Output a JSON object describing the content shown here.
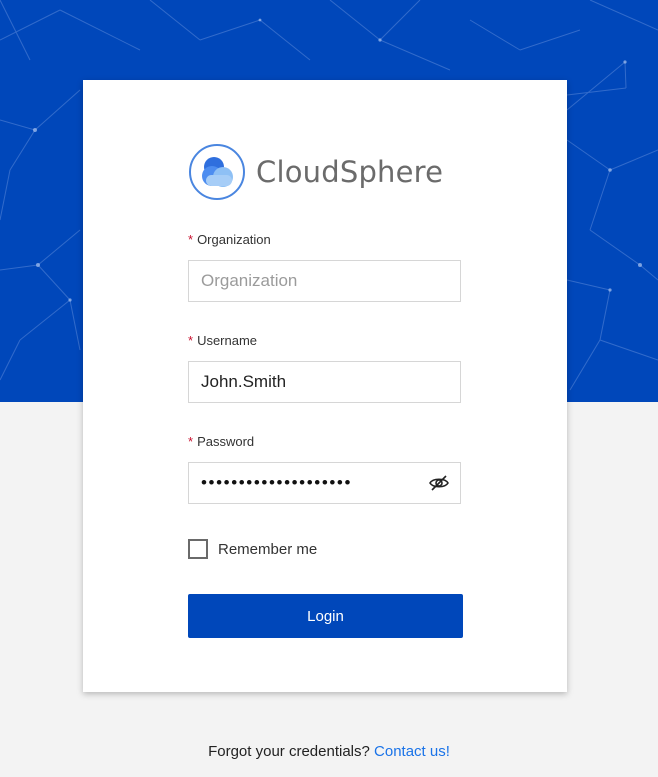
{
  "brand": {
    "name": "CloudSphere",
    "logo_icon": "cloud-icon",
    "primary_color": "#0047ba"
  },
  "form": {
    "organization": {
      "label": "Organization",
      "placeholder": "Organization",
      "value": "",
      "required_mark": "*"
    },
    "username": {
      "label": "Username",
      "placeholder": "",
      "value": "John.Smith",
      "required_mark": "*"
    },
    "password": {
      "label": "Password",
      "masked_value": "••••••••••••••••••••",
      "required_mark": "*",
      "toggle_icon": "eye-slash-icon"
    },
    "remember_me": {
      "label": "Remember me",
      "checked": false
    },
    "login_label": "Login"
  },
  "footer": {
    "text": "Forgot your credentials?",
    "link_text": "Contact us!"
  }
}
